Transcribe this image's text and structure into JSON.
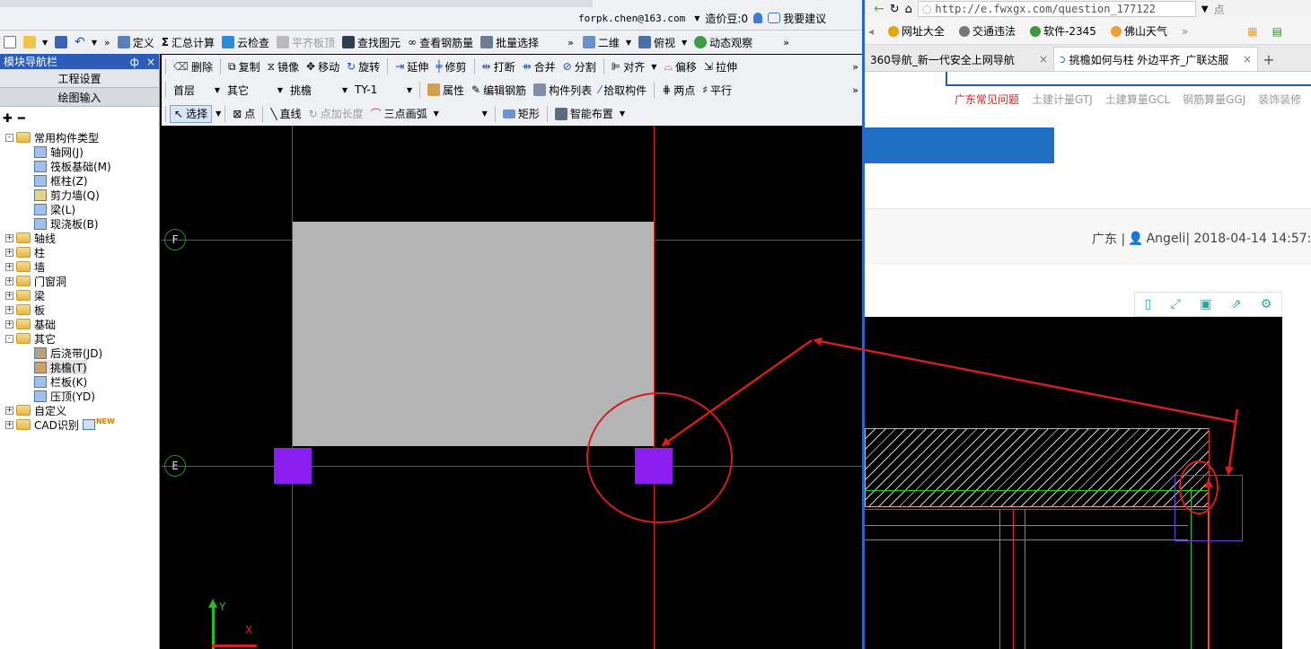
{
  "top_strip": {
    "email": "forpk.chen@163.com",
    "beans": "造价豆:0",
    "suggest": "我要建议"
  },
  "toolbar1": {
    "items": [
      "定义",
      "汇总计算",
      "云检查",
      "平齐板顶",
      "查找图元",
      "查看钢筋量",
      "批量选择"
    ],
    "view_mode": "二维",
    "view_angle": "俯视",
    "dynamic": "动态观察"
  },
  "panel": {
    "title": "模块导航栏",
    "pin": "ф",
    "close": "×",
    "project_settings": "工程设置",
    "drawing_input": "绘图输入"
  },
  "toolbar2": {
    "items": [
      "删除",
      "复制",
      "镜像",
      "移动",
      "旋转",
      "延伸",
      "修剪",
      "打断",
      "合并",
      "分割",
      "对齐",
      "偏移",
      "拉伸"
    ]
  },
  "toolbar3": {
    "floor": "首层",
    "category": "其它",
    "type": "挑檐",
    "name": "TY-1",
    "items": [
      "属性",
      "编辑钢筋",
      "构件列表",
      "拾取构件",
      "两点",
      "平行"
    ]
  },
  "toolbar4": {
    "select": "选择",
    "point": "点",
    "line": "直线",
    "point_length": "点加长度",
    "arc": "三点画弧",
    "rect": "矩形",
    "smart": "智能布置"
  },
  "tree": [
    {
      "label": "常用构件类型",
      "expand": "-"
    },
    {
      "label": "轴网(J)"
    },
    {
      "label": "筏板基础(M)"
    },
    {
      "label": "框柱(Z)"
    },
    {
      "label": "剪力墙(Q)"
    },
    {
      "label": "梁(L)"
    },
    {
      "label": "现浇板(B)"
    },
    {
      "label": "轴线",
      "expand": "+"
    },
    {
      "label": "柱",
      "expand": "+"
    },
    {
      "label": "墙",
      "expand": "+"
    },
    {
      "label": "门窗洞",
      "expand": "+"
    },
    {
      "label": "梁",
      "expand": "+"
    },
    {
      "label": "板",
      "expand": "+"
    },
    {
      "label": "基础",
      "expand": "+"
    },
    {
      "label": "其它",
      "expand": "-"
    },
    {
      "label": "后浇带(JD)"
    },
    {
      "label": "挑檐(T)"
    },
    {
      "label": "栏板(K)"
    },
    {
      "label": "压顶(YD)"
    },
    {
      "label": "自定义",
      "expand": "+"
    },
    {
      "label": "CAD识别",
      "expand": "+",
      "badge": "NEW"
    }
  ],
  "canvas": {
    "axis_f": "F",
    "axis_e": "E",
    "y_label": "Y",
    "x_label": "X"
  },
  "browser": {
    "url": "http://e.fwxgx.com/question_177122",
    "hint": "点",
    "bookmarks": [
      "网址大全",
      "交通违法",
      "软件-2345",
      "佛山天气"
    ],
    "tabs": [
      {
        "title": "360导航_新一代安全上网导航"
      },
      {
        "title": "挑檐如何与柱 外边平齐_广联达服"
      }
    ],
    "new_tab": "+",
    "nav_links": [
      "广东常见问题",
      "土建计量GTJ",
      "土建算量GCL",
      "钢筋算量GGJ",
      "装饰装修"
    ],
    "meta": "广东 | ",
    "author": "Angeli",
    "date": " | 2018-04-14 14:57:51"
  },
  "colors": {
    "accent_red": "#cc1f1a",
    "purple": "#8b1ff0",
    "link_red": "#d22",
    "banner_blue": "#1f6fc5"
  }
}
